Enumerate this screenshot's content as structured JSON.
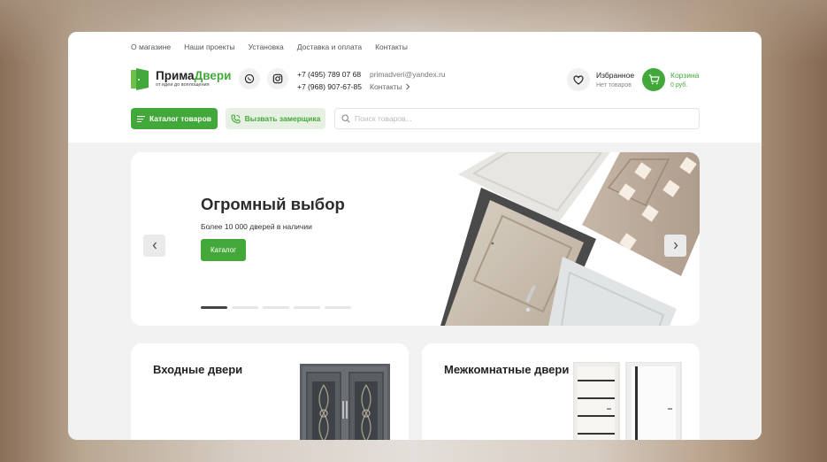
{
  "topnav": [
    "О магазине",
    "Наши проекты",
    "Установка",
    "Доставка и оплата",
    "Контакты"
  ],
  "logo": {
    "title_a": "Прима",
    "title_b": "Двери",
    "tagline": "от идеи до воплощения"
  },
  "phones": [
    "+7 (495) 789 07 68",
    "+7 (968) 907-67-85"
  ],
  "email": "primadveri@yandex.ru",
  "contacts_label": "Контакты",
  "favorites": {
    "title": "Избранное",
    "subtitle": "Нет товаров"
  },
  "cart": {
    "title": "Корзина",
    "subtitle": "0 руб."
  },
  "catalog_button": "Каталог товаров",
  "measure_button": "Вызвать замерщика",
  "search": {
    "placeholder": "Поиск товаров..."
  },
  "hero": {
    "title": "Огромный выбор",
    "subtitle": "Более 10 000 дверей в наличии",
    "button": "Каталог",
    "slide_count": 5,
    "active_slide": 0
  },
  "categories": [
    {
      "title": "Входные двери"
    },
    {
      "title": "Межкомнатные двери"
    }
  ],
  "colors": {
    "accent": "#43a83a",
    "accent_light": "#e6f1e3"
  }
}
